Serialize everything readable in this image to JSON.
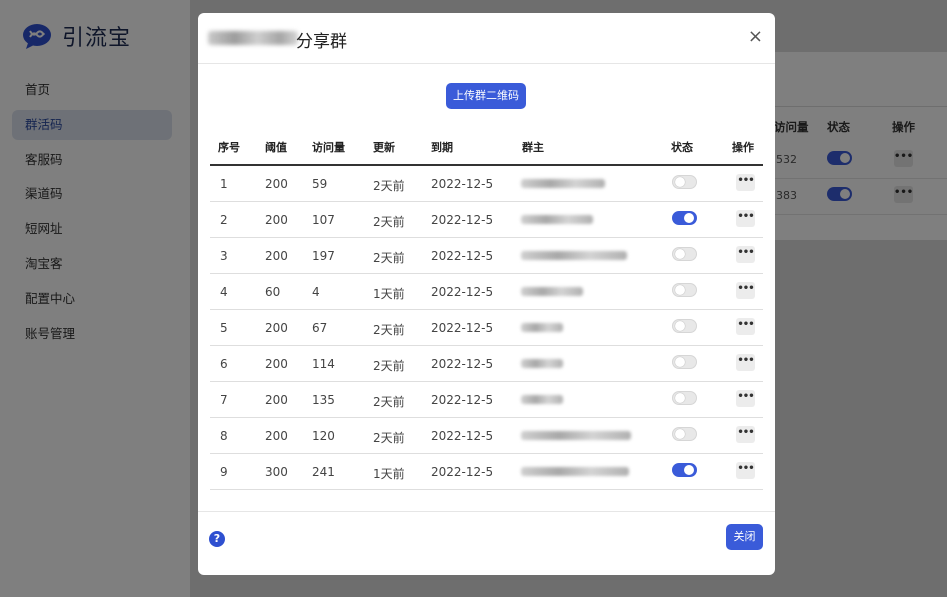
{
  "app": {
    "name": "引流宝"
  },
  "sidebar": {
    "items": [
      {
        "label": "首页",
        "active": false
      },
      {
        "label": "群活码",
        "active": true
      },
      {
        "label": "客服码",
        "active": false
      },
      {
        "label": "渠道码",
        "active": false
      },
      {
        "label": "短网址",
        "active": false
      },
      {
        "label": "淘宝客",
        "active": false
      },
      {
        "label": "配置中心",
        "active": false
      },
      {
        "label": "账号管理",
        "active": false
      }
    ]
  },
  "background_table": {
    "headers": {
      "visits": "访问量",
      "status": "状态",
      "actions": "操作"
    },
    "rows": [
      {
        "visits": "532"
      },
      {
        "visits": "383"
      }
    ]
  },
  "modal": {
    "title": "分享群",
    "close_symbol": "×",
    "upload_button": "上传群二维码",
    "columns": [
      "序号",
      "阈值",
      "访问量",
      "更新",
      "到期",
      "群主",
      "状态",
      "操作"
    ],
    "rows": [
      {
        "index": "1",
        "threshold": "200",
        "visits": "59",
        "updated": "2天前",
        "expires": "2022-12-5",
        "enabled": false
      },
      {
        "index": "2",
        "threshold": "200",
        "visits": "107",
        "updated": "2天前",
        "expires": "2022-12-5",
        "enabled": true
      },
      {
        "index": "3",
        "threshold": "200",
        "visits": "197",
        "updated": "2天前",
        "expires": "2022-12-5",
        "enabled": false
      },
      {
        "index": "4",
        "threshold": "60",
        "visits": "4",
        "updated": "1天前",
        "expires": "2022-12-5",
        "enabled": false
      },
      {
        "index": "5",
        "threshold": "200",
        "visits": "67",
        "updated": "2天前",
        "expires": "2022-12-5",
        "enabled": false
      },
      {
        "index": "6",
        "threshold": "200",
        "visits": "114",
        "updated": "2天前",
        "expires": "2022-12-5",
        "enabled": false
      },
      {
        "index": "7",
        "threshold": "200",
        "visits": "135",
        "updated": "2天前",
        "expires": "2022-12-5",
        "enabled": false
      },
      {
        "index": "8",
        "threshold": "200",
        "visits": "120",
        "updated": "2天前",
        "expires": "2022-12-5",
        "enabled": false
      },
      {
        "index": "9",
        "threshold": "300",
        "visits": "241",
        "updated": "1天前",
        "expires": "2022-12-5",
        "enabled": true
      }
    ],
    "more_symbol": "•••",
    "help_symbol": "?",
    "close_button": "关闭"
  },
  "colors": {
    "accent": "#3a5bd9",
    "overlay": "rgba(0,0,0,0.5)"
  },
  "icons": {
    "logo": "chat-bubble-logo-icon",
    "help": "question-circle-icon",
    "close": "close-icon",
    "more": "more-dots-icon"
  }
}
